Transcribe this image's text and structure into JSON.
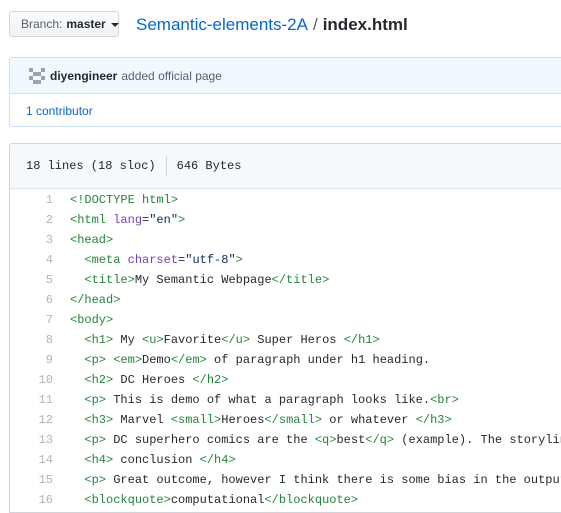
{
  "branch": {
    "label": "Branch:",
    "value": "master"
  },
  "breadcrumb": {
    "repo": "Semantic-elements-2A",
    "separator": "/",
    "file": "index.html"
  },
  "commit": {
    "author": "diyengineer",
    "message": "added official page",
    "contributors": "1 contributor"
  },
  "file_info": {
    "lines": "18 lines (18 sloc)",
    "size": "646 Bytes"
  },
  "code_lines": [
    [
      [
        "t",
        "<!DOCTYPE html>"
      ]
    ],
    [
      [
        "t",
        "<html"
      ],
      [
        "p",
        " "
      ],
      [
        "a",
        "lang"
      ],
      [
        "p",
        "="
      ],
      [
        "s",
        "\"en\""
      ],
      [
        "t",
        ">"
      ]
    ],
    [
      [
        "t",
        "<head>"
      ]
    ],
    [
      [
        "p",
        "  "
      ],
      [
        "t",
        "<meta"
      ],
      [
        "p",
        " "
      ],
      [
        "a",
        "charset"
      ],
      [
        "p",
        "="
      ],
      [
        "s",
        "\"utf-8\""
      ],
      [
        "t",
        ">"
      ]
    ],
    [
      [
        "p",
        "  "
      ],
      [
        "t",
        "<title>"
      ],
      [
        "p",
        "My Semantic Webpage"
      ],
      [
        "t",
        "</title>"
      ]
    ],
    [
      [
        "t",
        "</head>"
      ]
    ],
    [
      [
        "t",
        "<body>"
      ]
    ],
    [
      [
        "p",
        "  "
      ],
      [
        "t",
        "<h1>"
      ],
      [
        "p",
        " My "
      ],
      [
        "t",
        "<u>"
      ],
      [
        "p",
        "Favorite"
      ],
      [
        "t",
        "</u>"
      ],
      [
        "p",
        " Super Heros "
      ],
      [
        "t",
        "</h1>"
      ]
    ],
    [
      [
        "p",
        "  "
      ],
      [
        "t",
        "<p>"
      ],
      [
        "p",
        " "
      ],
      [
        "t",
        "<em>"
      ],
      [
        "p",
        "Demo"
      ],
      [
        "t",
        "</em>"
      ],
      [
        "p",
        " of paragraph under h1 heading."
      ]
    ],
    [
      [
        "p",
        "  "
      ],
      [
        "t",
        "<h2>"
      ],
      [
        "p",
        " DC Heroes "
      ],
      [
        "t",
        "</h2>"
      ]
    ],
    [
      [
        "p",
        "  "
      ],
      [
        "t",
        "<p>"
      ],
      [
        "p",
        " This is demo of what a paragraph looks like."
      ],
      [
        "t",
        "<br>"
      ]
    ],
    [
      [
        "p",
        "  "
      ],
      [
        "t",
        "<h3>"
      ],
      [
        "p",
        " Marvel "
      ],
      [
        "t",
        "<small>"
      ],
      [
        "p",
        "Heroes"
      ],
      [
        "t",
        "</small>"
      ],
      [
        "p",
        " or whatever "
      ],
      [
        "t",
        "</h3>"
      ]
    ],
    [
      [
        "p",
        "  "
      ],
      [
        "t",
        "<p>"
      ],
      [
        "p",
        " DC superhero comics are the "
      ],
      [
        "t",
        "<q>"
      ],
      [
        "p",
        "best"
      ],
      [
        "t",
        "</q>"
      ],
      [
        "p",
        " (example). The storyline"
      ]
    ],
    [
      [
        "p",
        "  "
      ],
      [
        "t",
        "<h4>"
      ],
      [
        "p",
        " conclusion "
      ],
      [
        "t",
        "</h4>"
      ]
    ],
    [
      [
        "p",
        "  "
      ],
      [
        "t",
        "<p>"
      ],
      [
        "p",
        " Great outcome, however I think there is some bias in the output"
      ]
    ],
    [
      [
        "p",
        "  "
      ],
      [
        "t",
        "<blockquote>"
      ],
      [
        "p",
        "computational"
      ],
      [
        "t",
        "</blockquote>"
      ]
    ]
  ]
}
